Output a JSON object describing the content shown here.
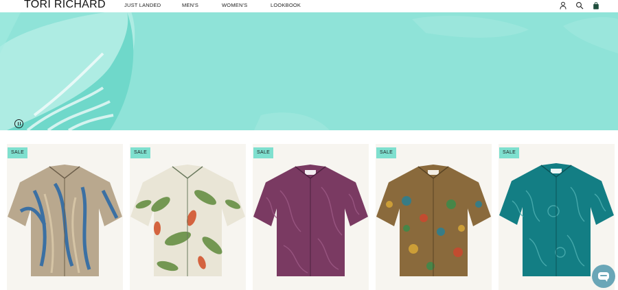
{
  "header": {
    "logo": "TORI RICHARD",
    "nav": [
      {
        "label": "JUST LANDED"
      },
      {
        "label": "MEN'S"
      },
      {
        "label": "WOMEN'S"
      },
      {
        "label": "LOOKBOOK"
      }
    ],
    "icons": [
      "account-icon",
      "search-icon",
      "bag-icon"
    ]
  },
  "hero": {
    "background_color": "#8fe3d8",
    "pause_icon": "pause-icon"
  },
  "products": [
    {
      "badge": "SALE",
      "shirt_color": "#b9a88e",
      "print_color": "#2e6aa6"
    },
    {
      "badge": "SALE",
      "shirt_color": "#e9e5d6",
      "print_color": "#5f8a3c"
    },
    {
      "badge": "SALE",
      "shirt_color": "#7a3a62",
      "print_color": "#9d5a86"
    },
    {
      "badge": "SALE",
      "shirt_color": "#8a6a3c",
      "print_color": "#2f7f8f"
    },
    {
      "badge": "SALE",
      "shirt_color": "#137e84",
      "print_color": "#4eb0b2"
    }
  ],
  "colors": {
    "accent_teal": "#7fe0cf",
    "card_background": "#f7f5f0",
    "chat_button": "#6aa6b7"
  },
  "chat": {
    "icon": "chat-icon"
  }
}
